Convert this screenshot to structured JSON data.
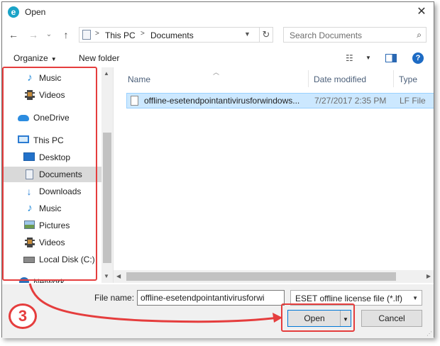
{
  "window": {
    "title": "Open",
    "app_icon": "e"
  },
  "nav": {
    "back": "←",
    "forward": "→",
    "recent": "⌄",
    "up": "↑"
  },
  "address": {
    "crumbs": [
      "This PC",
      "Documents"
    ],
    "refresh": "↻"
  },
  "search": {
    "placeholder": "Search Documents"
  },
  "toolbar": {
    "organize": "Organize",
    "new_folder": "New folder",
    "help": "?"
  },
  "sidebar": {
    "items": [
      {
        "label": "Music",
        "icon": "music-icon"
      },
      {
        "label": "Videos",
        "icon": "video-icon"
      },
      {
        "label": "OneDrive",
        "icon": "onedrive-icon"
      },
      {
        "label": "This PC",
        "icon": "computer-icon"
      },
      {
        "label": "Desktop",
        "icon": "desktop-icon"
      },
      {
        "label": "Documents",
        "icon": "documents-icon",
        "selected": true
      },
      {
        "label": "Downloads",
        "icon": "downloads-icon"
      },
      {
        "label": "Music",
        "icon": "music-icon"
      },
      {
        "label": "Pictures",
        "icon": "pictures-icon"
      },
      {
        "label": "Videos",
        "icon": "video-icon"
      },
      {
        "label": "Local Disk (C:)",
        "icon": "disk-icon"
      },
      {
        "label": "Network",
        "icon": "network-icon"
      }
    ]
  },
  "columns": {
    "name": "Name",
    "date": "Date modified",
    "type": "Type"
  },
  "files": [
    {
      "name": "offline-esetendpointantivirusforwindows...",
      "date": "7/27/2017 2:35 PM",
      "type": "LF File"
    }
  ],
  "bottom": {
    "file_name_label": "File name:",
    "file_name_value": "offline-esetendpointantivirusforwi",
    "filter": "ESET offline license file (*.lf)",
    "open": "Open",
    "cancel": "Cancel"
  },
  "annotation": {
    "step": "3",
    "color": "#e53d3d"
  }
}
